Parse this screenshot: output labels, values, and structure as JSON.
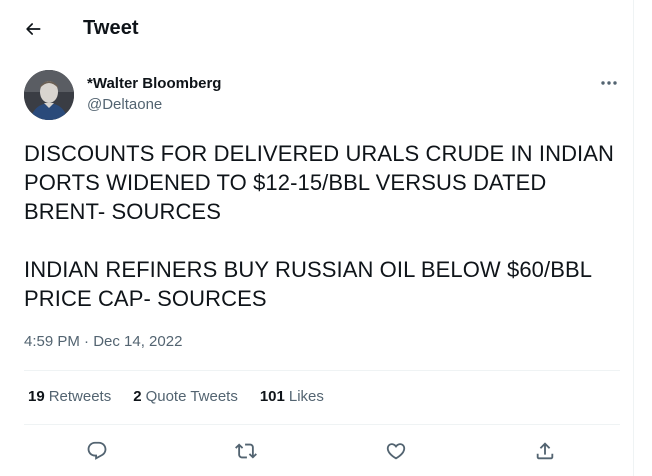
{
  "header": {
    "title": "Tweet",
    "back_icon": "arrow-left-icon"
  },
  "author": {
    "name": "*Walter Bloomberg",
    "handle": "@Deltaone",
    "more_icon": "more-horizontal-icon"
  },
  "tweet": {
    "text": "DISCOUNTS FOR DELIVERED URALS CRUDE IN INDIAN PORTS WIDENED TO $12-15/BBL VERSUS DATED BRENT- SOURCES\n\nINDIAN REFINERS BUY RUSSIAN OIL BELOW $60/BBL PRICE CAP- SOURCES",
    "timestamp": "4:59 PM · Dec 14, 2022"
  },
  "stats": {
    "retweets_count": "19",
    "retweets_label": "Retweets",
    "quotes_count": "2",
    "quotes_label": "Quote Tweets",
    "likes_count": "101",
    "likes_label": "Likes"
  },
  "actions": {
    "reply_icon": "reply-icon",
    "retweet_icon": "retweet-icon",
    "like_icon": "heart-icon",
    "share_icon": "share-icon"
  },
  "colors": {
    "text_primary": "#0f1419",
    "text_secondary": "#536471",
    "divider": "#eff3f4"
  }
}
